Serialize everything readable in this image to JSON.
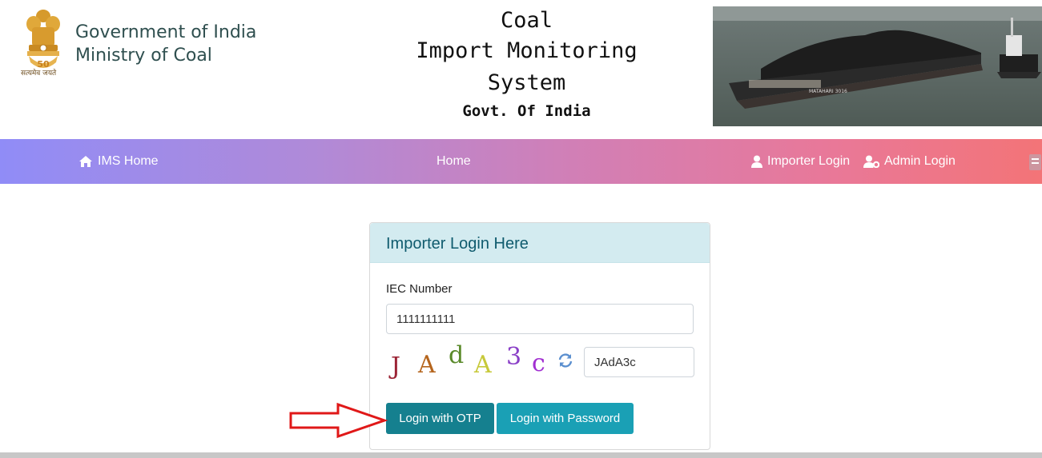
{
  "header": {
    "gov_line1": "Government of India",
    "gov_line2": "Ministry of Coal",
    "emblem_motto": "सत्यमेव जयते",
    "title_line1": "Coal",
    "title_line2": "Import Monitoring System",
    "title_line3": "Govt. Of India",
    "photo_text": "MATAHARI 3016"
  },
  "nav": {
    "ims_home": "IMS Home",
    "home": "Home",
    "importer_login": "Importer Login",
    "admin_login": "Admin Login"
  },
  "login_card": {
    "heading": "Importer Login Here",
    "iec_label": "IEC Number",
    "iec_value": "1111111111",
    "captcha_chars": [
      "J",
      "A",
      "d",
      "A",
      "3",
      "c"
    ],
    "captcha_colors": [
      "#9b2335",
      "#b5651d",
      "#5a8a2a",
      "#c7c93a",
      "#8a3fc7",
      "#a12fd1"
    ],
    "captcha_value": "JAdA3c",
    "otp_button": "Login with OTP",
    "password_button": "Login with Password"
  },
  "colors": {
    "nav_gradient_start": "#908cf7",
    "nav_gradient_end": "#f37477",
    "card_header_bg": "#d3ebf0",
    "otp_button_bg": "#15808f",
    "password_button_bg": "#1aa0b5",
    "annotation_arrow": "#e01818"
  }
}
